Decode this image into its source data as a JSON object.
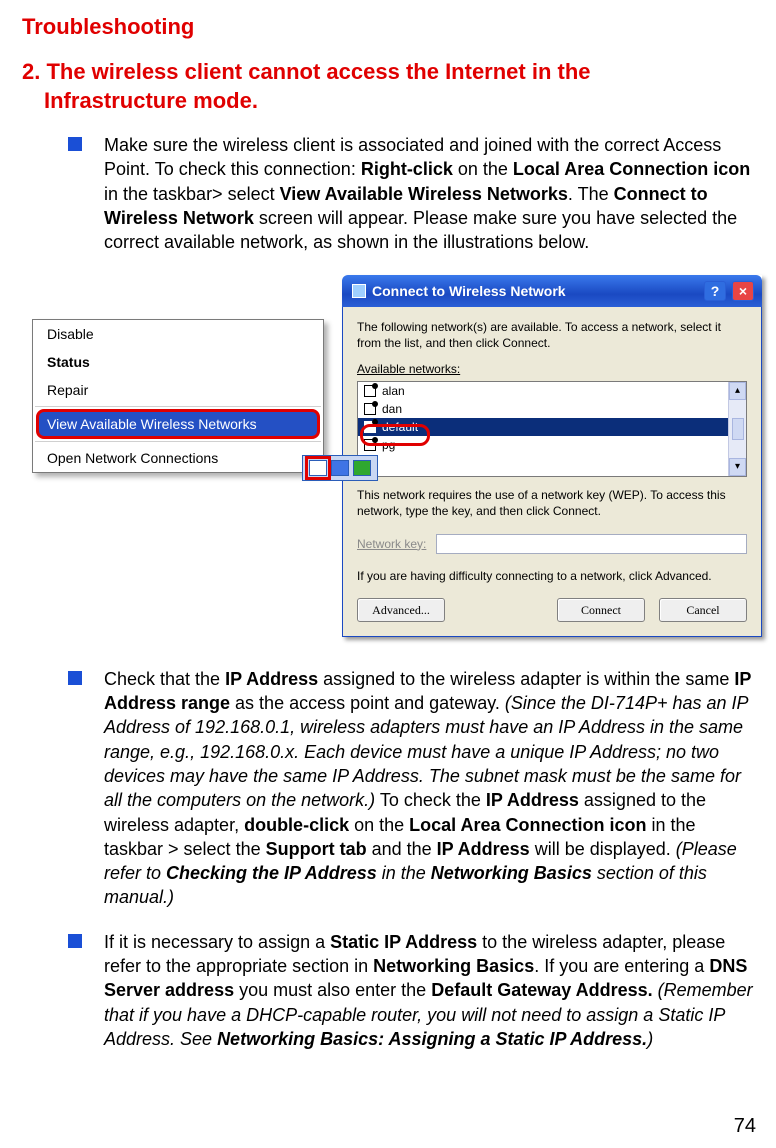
{
  "title": "Troubleshooting",
  "subhead_line1": "2. The wireless client cannot access the Internet in the",
  "subhead_line2": "Infrastructure mode.",
  "bullets": {
    "b1": {
      "p1a": "Make sure the wireless client is associated and joined with the correct Access Point.  To check this connection:  ",
      "p1b_bold": "Right-click",
      "p1c": " on the ",
      "p1d_bold": "Local Area Connection icon",
      "p1e": " in the taskbar> select ",
      "p1f_bold": "View Available Wireless Networks",
      "p1g": ".  The ",
      "p1h_bold": "Connect to Wireless Network",
      "p1i": " screen will appear.  Please make sure you have selected the correct available network, as shown in the illustrations below."
    },
    "b2": {
      "p2a": "Check that the ",
      "p2b_bold": "IP Address",
      "p2c": " assigned to the wireless adapter is within the same ",
      "p2d_bold": "IP Address range",
      "p2e": " as the access point and gateway.  ",
      "p2f_ital": "(Since the DI-714P+ has an IP Address of 192.168.0.1, wireless adapters must have an IP Address in the same range, e.g., 192.168.0.x.  Each device must have a unique IP Address; no two devices may have the same IP Address. The subnet mask must be the same for all the computers on the network.)",
      "p2g": "  To check the ",
      "p2h_bold": "IP Address",
      "p2i": " assigned to the wireless adapter, ",
      "p2j_bold": "double-click",
      "p2k": " on the ",
      "p2l_bold": "Local Area Connection icon",
      "p2m": " in the taskbar > select the ",
      "p2n_bold": "Support tab",
      "p2o": " and the ",
      "p2p_bold": "IP Address",
      "p2q": " will be displayed.  ",
      "p2r_ital_a": "(Please refer to ",
      "p2r_ital_b_boldital": "Checking the IP Address",
      "p2r_ital_c": " in the ",
      "p2r_ital_d_boldital": "Networking Basics",
      "p2r_ital_e": " section of this manual.)"
    },
    "b3": {
      "p3a": "If it is necessary to assign a ",
      "p3b_bold": "Static IP Address",
      "p3c": " to the wireless adapter, please refer to the appropriate section in ",
      "p3d_bold": "Networking Basics",
      "p3e": ".  If you are entering a ",
      "p3f_bold": "DNS Server address",
      "p3g": " you must also enter the ",
      "p3h_bold": "Default Gateway Address.",
      "p3i": "  ",
      "p3j_ital_a": "(Remember that if you have a DHCP-capable router, you will not need to assign a Static IP Address.  See  ",
      "p3j_ital_b_boldital": "Networking Basics: Assigning a Static IP Address.",
      "p3j_ital_c": ")"
    }
  },
  "ctxmenu": {
    "items": [
      "Disable",
      "Status",
      "Repair",
      "View Available Wireless Networks",
      "Open Network Connections"
    ],
    "highlightIndex": 3,
    "boldIndex": 1
  },
  "dialog": {
    "title": "Connect to Wireless Network",
    "intro": "The following network(s) are available. To access a network, select it from the list, and then click Connect.",
    "available_label": "Available networks:",
    "networks": [
      "alan",
      "dan",
      "default",
      "pg"
    ],
    "selectedIndex": 2,
    "gray_note": "This network requires the use of a network key (WEP). To access this network, type the key, and then click Connect.",
    "key_label": "Network key:",
    "key_value": "",
    "adv_note": "If you are having difficulty connecting to a network, click Advanced.",
    "buttons": {
      "advanced": "Advanced...",
      "connect": "Connect",
      "cancel": "Cancel"
    }
  },
  "page_number": "74"
}
